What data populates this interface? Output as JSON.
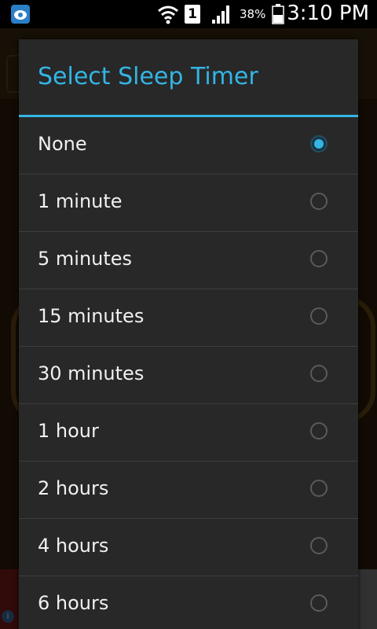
{
  "status_bar": {
    "sim_label": "1",
    "battery_percent": "38%",
    "time": "3:10 PM",
    "icons": [
      "app-notification-icon",
      "wifi-icon",
      "signal-icon",
      "battery-icon"
    ]
  },
  "dialog": {
    "title": "Select Sleep Timer",
    "options": [
      {
        "label": "None",
        "selected": true
      },
      {
        "label": "1 minute",
        "selected": false
      },
      {
        "label": "5 minutes",
        "selected": false
      },
      {
        "label": "15 minutes",
        "selected": false
      },
      {
        "label": "30 minutes",
        "selected": false
      },
      {
        "label": "1 hour",
        "selected": false
      },
      {
        "label": "2 hours",
        "selected": false
      },
      {
        "label": "4 hours",
        "selected": false
      },
      {
        "label": "6 hours",
        "selected": false
      }
    ]
  },
  "colors": {
    "accent": "#33b5e5",
    "dialog_bg": "#282828",
    "text": "#f0f0f0",
    "divider": "#3d3d3d"
  }
}
